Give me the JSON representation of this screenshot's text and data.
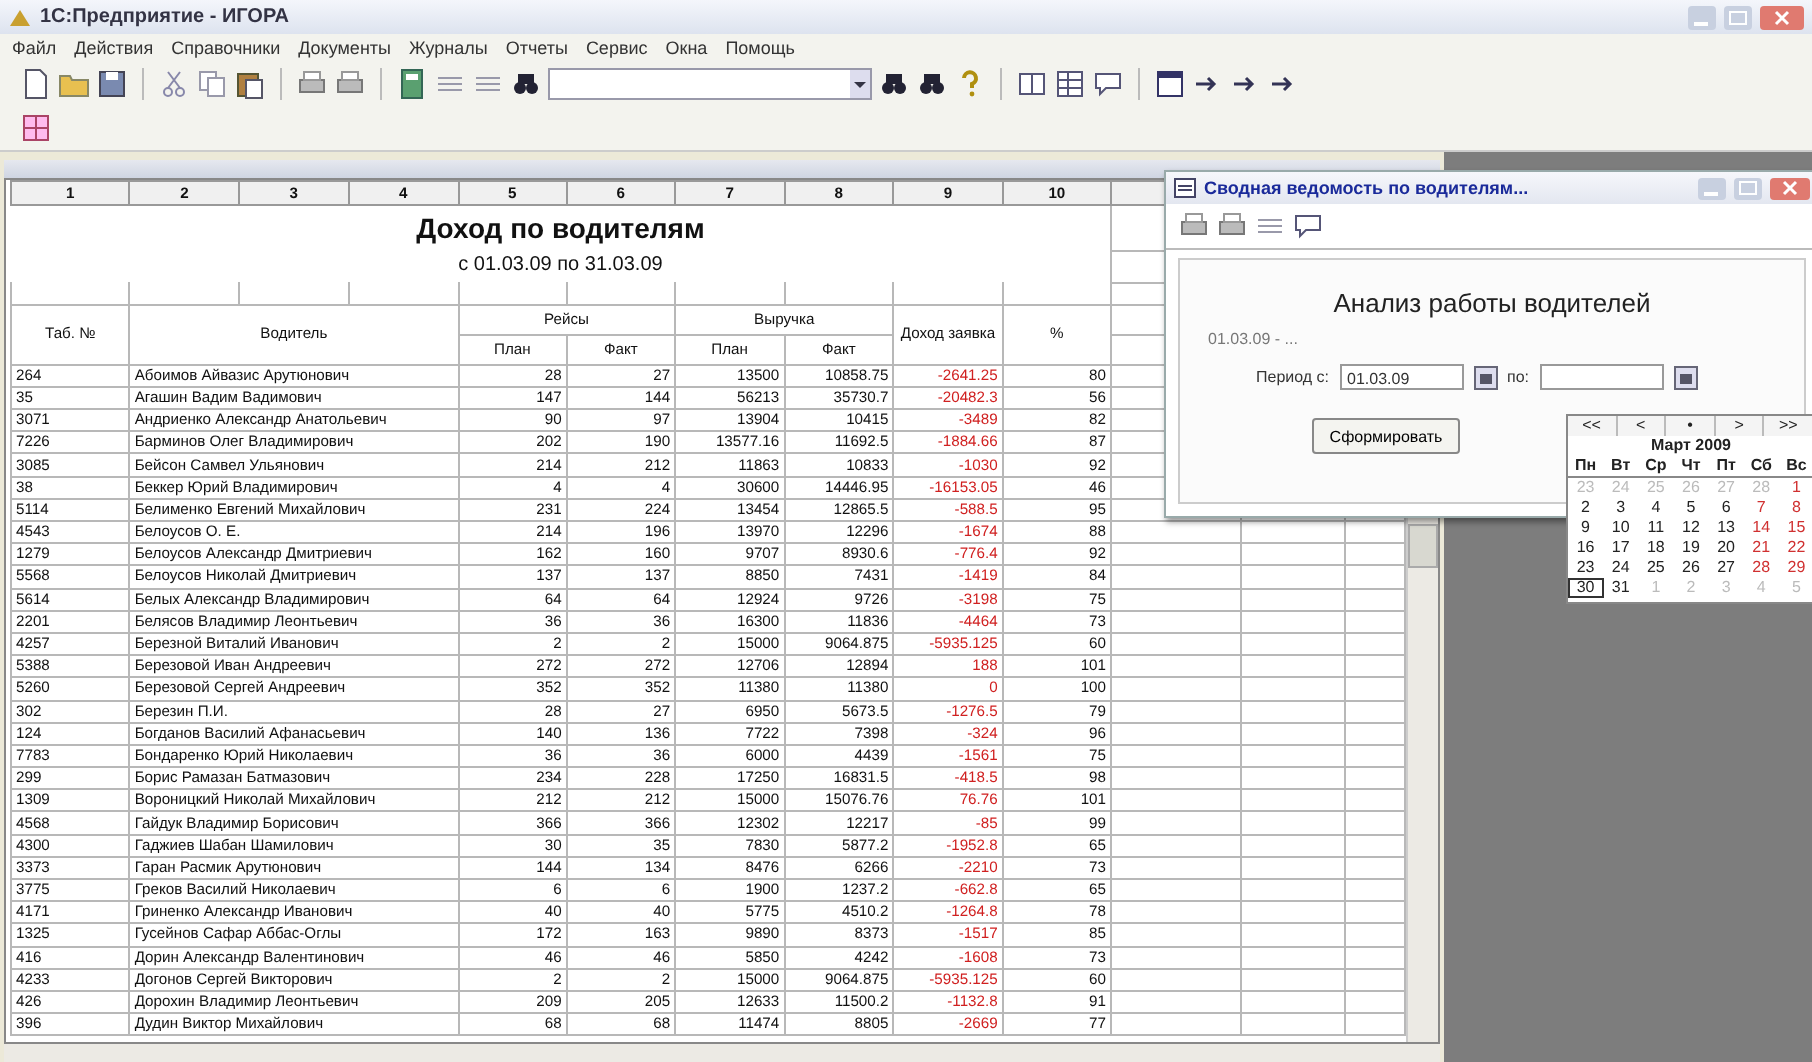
{
  "window": {
    "title": "1С:Предприятие - ИГОРА"
  },
  "menu": [
    "Файл",
    "Действия",
    "Справочники",
    "Документы",
    "Журналы",
    "Отчеты",
    "Сервис",
    "Окна",
    "Помощь"
  ],
  "report": {
    "column_numbers": [
      "1",
      "2",
      "3",
      "4",
      "5",
      "6",
      "7",
      "8",
      "9",
      "10"
    ],
    "title": "Доход по водителям",
    "period": "с 01.03.09 по 31.03.09",
    "headers": {
      "tab_no": "Таб. №",
      "driver": "Водитель",
      "trips": "Рейсы",
      "revenue": "Выручка",
      "income": "Доход заявка",
      "percent": "%"
    },
    "trips_sub": [
      "План",
      "Факт"
    ],
    "revenue_sub": [
      "План",
      "Факт"
    ],
    "rows": [
      [
        "264",
        "Абоимов Айвазис Арутюнович",
        "28",
        "27",
        "13500",
        "10858.75",
        "-2641.25",
        "80"
      ],
      [
        "35",
        "Агашин Вадим Вадимович",
        "147",
        "144",
        "56213",
        "35730.7",
        "-20482.3",
        "56"
      ],
      [
        "3071",
        "Андриенко Александр Анатольевич",
        "90",
        "97",
        "13904",
        "10415",
        "-3489",
        "82"
      ],
      [
        "7226",
        "Барминов Олег Владимирович",
        "202",
        "190",
        "13577.16",
        "11692.5",
        "-1884.66",
        "87"
      ],
      [
        "3085",
        "Бейсон Самвел Ульянович",
        "214",
        "212",
        "11863",
        "10833",
        "-1030",
        "92"
      ],
      [
        "38",
        "Беккер Юрий Владимирович",
        "4",
        "4",
        "30600",
        "14446.95",
        "-16153.05",
        "46"
      ],
      [
        "5114",
        "Белименко Евгений Михайлович",
        "231",
        "224",
        "13454",
        "12865.5",
        "-588.5",
        "95"
      ],
      [
        "4543",
        "Белоусов О. Е.",
        "214",
        "196",
        "13970",
        "12296",
        "-1674",
        "88"
      ],
      [
        "1279",
        "Белоусов Александр Дмитриевич",
        "162",
        "160",
        "9707",
        "8930.6",
        "-776.4",
        "92"
      ],
      [
        "5568",
        "Белоусов Николай Дмитриевич",
        "137",
        "137",
        "8850",
        "7431",
        "-1419",
        "84"
      ],
      [
        "5614",
        "Белых Александр Владимирович",
        "64",
        "64",
        "12924",
        "9726",
        "-3198",
        "75"
      ],
      [
        "2201",
        "Белясов Владимир Леонтьевич",
        "36",
        "36",
        "16300",
        "11836",
        "-4464",
        "73"
      ],
      [
        "4257",
        "Березной Виталий Иванович",
        "2",
        "2",
        "15000",
        "9064.875",
        "-5935.125",
        "60"
      ],
      [
        "5388",
        "Березовой Иван Андреевич",
        "272",
        "272",
        "12706",
        "12894",
        "188",
        "101"
      ],
      [
        "5260",
        "Березовой Сергей Андреевич",
        "352",
        "352",
        "11380",
        "11380",
        "0",
        "100"
      ],
      [
        "302",
        "Березин П.И.",
        "28",
        "27",
        "6950",
        "5673.5",
        "-1276.5",
        "79"
      ],
      [
        "124",
        "Богданов Василий Афанасьевич",
        "140",
        "136",
        "7722",
        "7398",
        "-324",
        "96"
      ],
      [
        "7783",
        "Бондаренко Юрий Николаевич",
        "36",
        "36",
        "6000",
        "4439",
        "-1561",
        "75"
      ],
      [
        "299",
        "Борис Рамазан Батмазович",
        "234",
        "228",
        "17250",
        "16831.5",
        "-418.5",
        "98"
      ],
      [
        "1309",
        "Вороницкий Николай Михайлович",
        "212",
        "212",
        "15000",
        "15076.76",
        "76.76",
        "101"
      ],
      [
        "4568",
        "Гайдук Владимир Борисович",
        "366",
        "366",
        "12302",
        "12217",
        "-85",
        "99"
      ],
      [
        "4300",
        "Гаджиев Шабан Шамилович",
        "30",
        "35",
        "7830",
        "5877.2",
        "-1952.8",
        "65"
      ],
      [
        "3373",
        "Гаран Расмик Арутюнович",
        "144",
        "134",
        "8476",
        "6266",
        "-2210",
        "73"
      ],
      [
        "3775",
        "Греков Василий Николаевич",
        "6",
        "6",
        "1900",
        "1237.2",
        "-662.8",
        "65"
      ],
      [
        "4171",
        "Гриненко Александр Иванович",
        "40",
        "40",
        "5775",
        "4510.2",
        "-1264.8",
        "78"
      ],
      [
        "1325",
        "Гусейнов Сафар Аббас-Оглы",
        "172",
        "163",
        "9890",
        "8373",
        "-1517",
        "85"
      ],
      [
        "416",
        "Дорин Александр Валентинович",
        "46",
        "46",
        "5850",
        "4242",
        "-1608",
        "73"
      ],
      [
        "4233",
        "Догонов Сергей Викторович",
        "2",
        "2",
        "15000",
        "9064.875",
        "-5935.125",
        "60"
      ],
      [
        "426",
        "Дорохин Владимир Леонтьевич",
        "209",
        "205",
        "12633",
        "11500.2",
        "-1132.8",
        "91"
      ],
      [
        "396",
        "Дудин Виктор Михайлович",
        "68",
        "68",
        "11474",
        "8805",
        "-2669",
        "77"
      ]
    ]
  },
  "dialog": {
    "title": "Сводная ведомость по водителям...",
    "heading": "Анализ работы водителей",
    "subtitle": "01.03.09 - ...",
    "period_label": "Период с:",
    "date_from": "01.03.09",
    "to_label": "по:",
    "generate_button": "Сформировать"
  },
  "calendar": {
    "nav": [
      "<<",
      "<",
      "•",
      ">",
      ">>"
    ],
    "month": "Март 2009",
    "weekdays": [
      "Пн",
      "Вт",
      "Ср",
      "Чт",
      "Пт",
      "Сб",
      "Вс"
    ],
    "weeks": [
      [
        {
          "d": "23",
          "muted": true,
          "selected": false
        },
        {
          "d": "24",
          "muted": true,
          "selected": false
        },
        {
          "d": "25",
          "muted": true,
          "selected": false
        },
        {
          "d": "26",
          "muted": true,
          "selected": false
        },
        {
          "d": "27",
          "muted": true,
          "selected": false
        },
        {
          "d": "28",
          "muted": true,
          "selected": false
        },
        {
          "d": "1",
          "muted": false,
          "selected": false
        }
      ],
      [
        {
          "d": "2",
          "muted": false,
          "selected": false
        },
        {
          "d": "3",
          "muted": false,
          "selected": false
        },
        {
          "d": "4",
          "muted": false,
          "selected": false
        },
        {
          "d": "5",
          "muted": false,
          "selected": false
        },
        {
          "d": "6",
          "muted": false,
          "selected": false
        },
        {
          "d": "7",
          "muted": false,
          "selected": false
        },
        {
          "d": "8",
          "muted": false,
          "selected": false
        }
      ],
      [
        {
          "d": "9",
          "muted": false,
          "selected": false
        },
        {
          "d": "10",
          "muted": false,
          "selected": false
        },
        {
          "d": "11",
          "muted": false,
          "selected": false
        },
        {
          "d": "12",
          "muted": false,
          "selected": false
        },
        {
          "d": "13",
          "muted": false,
          "selected": false
        },
        {
          "d": "14",
          "muted": false,
          "selected": false
        },
        {
          "d": "15",
          "muted": false,
          "selected": false
        }
      ],
      [
        {
          "d": "16",
          "muted": false,
          "selected": false
        },
        {
          "d": "17",
          "muted": false,
          "selected": false
        },
        {
          "d": "18",
          "muted": false,
          "selected": false
        },
        {
          "d": "19",
          "muted": false,
          "selected": false
        },
        {
          "d": "20",
          "muted": false,
          "selected": false
        },
        {
          "d": "21",
          "muted": false,
          "selected": false
        },
        {
          "d": "22",
          "muted": false,
          "selected": false
        }
      ],
      [
        {
          "d": "23",
          "muted": false,
          "selected": false
        },
        {
          "d": "24",
          "muted": false,
          "selected": false
        },
        {
          "d": "25",
          "muted": false,
          "selected": false
        },
        {
          "d": "26",
          "muted": false,
          "selected": false
        },
        {
          "d": "27",
          "muted": false,
          "selected": false
        },
        {
          "d": "28",
          "muted": false,
          "selected": false
        },
        {
          "d": "29",
          "muted": false,
          "selected": false
        }
      ],
      [
        {
          "d": "30",
          "muted": false,
          "selected": true
        },
        {
          "d": "31",
          "muted": false,
          "selected": false
        },
        {
          "d": "1",
          "muted": true,
          "selected": false
        },
        {
          "d": "2",
          "muted": true,
          "selected": false
        },
        {
          "d": "3",
          "muted": true,
          "selected": false
        },
        {
          "d": "4",
          "muted": true,
          "selected": false
        },
        {
          "d": "5",
          "muted": true,
          "selected": false
        }
      ]
    ]
  }
}
